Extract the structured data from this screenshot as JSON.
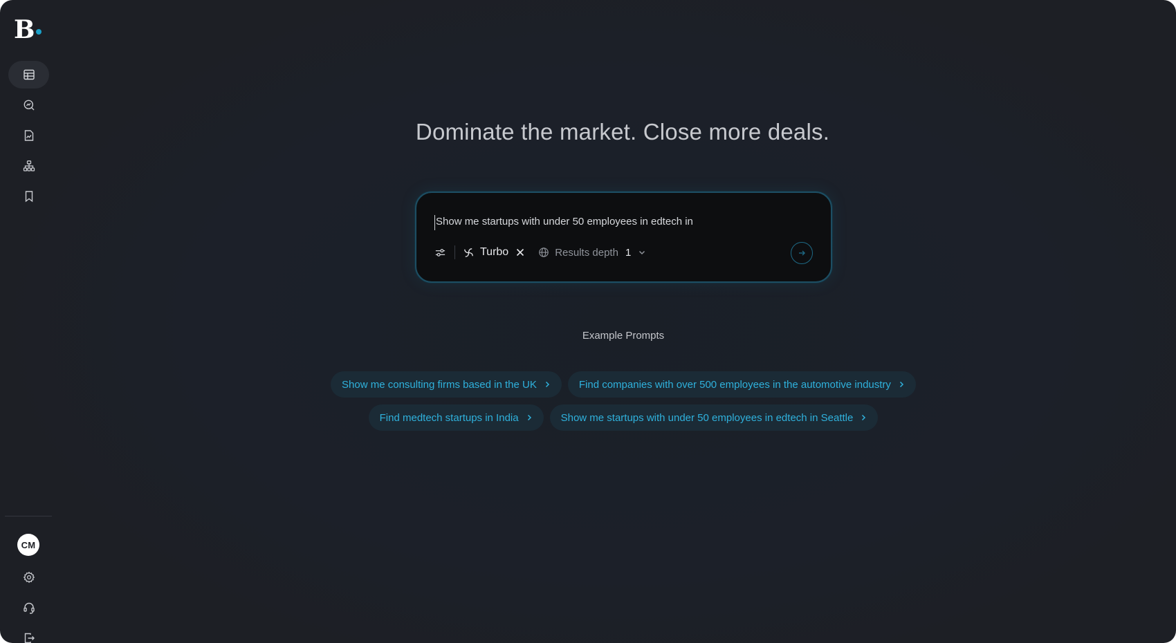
{
  "brand": {
    "logo_letter": "B",
    "accent": "#1aa0c8"
  },
  "sidebar": {
    "items": [
      {
        "icon": "table-icon",
        "active": true
      },
      {
        "icon": "search-analytics-icon",
        "active": false
      },
      {
        "icon": "report-icon",
        "active": false
      },
      {
        "icon": "org-chart-icon",
        "active": false
      },
      {
        "icon": "bookmark-icon",
        "active": false
      }
    ],
    "bottom": [
      {
        "icon": "gear-icon"
      },
      {
        "icon": "headset-icon"
      },
      {
        "icon": "logout-icon"
      }
    ],
    "avatar_initials": "CM"
  },
  "main": {
    "headline": "Dominate the market. Close more deals.",
    "search": {
      "value": "Show me startups with under 50 employees in edtech in",
      "mode_label": "Turbo",
      "depth_label": "Results depth",
      "depth_value": "1"
    },
    "examples_title": "Example Prompts",
    "example_prompts": [
      "Show me consulting firms based in the UK",
      "Find companies with over 500 employees in the automotive industry",
      "Find medtech startups in India",
      "Show me startups with under 50 employees in edtech in Seattle"
    ]
  }
}
